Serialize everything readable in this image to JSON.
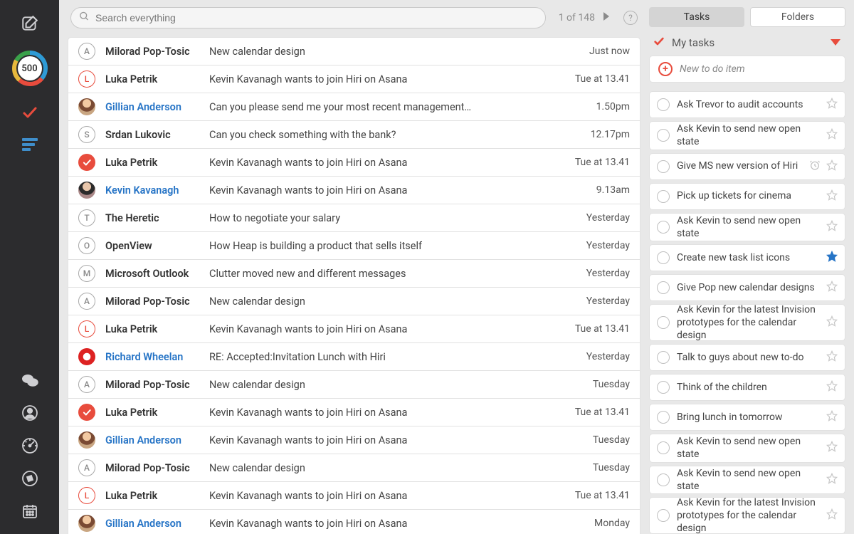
{
  "rail": {
    "score": "500"
  },
  "search": {
    "placeholder": "Search everything"
  },
  "pager": {
    "text": "1 of 148"
  },
  "messages": [
    {
      "avatar": {
        "kind": "letter",
        "text": "A"
      },
      "sender": "Milorad Pop-Tosic",
      "link": false,
      "subject": "New calendar design",
      "when": "Just now"
    },
    {
      "avatar": {
        "kind": "letter-orange",
        "text": "L"
      },
      "sender": "Luka Petrik",
      "link": false,
      "subject": "Kevin Kavanagh wants to join Hiri on Asana",
      "when": "Tue at 13.41"
    },
    {
      "avatar": {
        "kind": "photo-g"
      },
      "sender": "Gillian Anderson",
      "link": true,
      "subject": "Can you please send me your most recent management…",
      "when": "1.50pm"
    },
    {
      "avatar": {
        "kind": "letter",
        "text": "S"
      },
      "sender": "Srdan Lukovic",
      "link": false,
      "subject": "Can you check something with the bank?",
      "when": "12.17pm"
    },
    {
      "avatar": {
        "kind": "check"
      },
      "sender": "Luka Petrik",
      "link": false,
      "subject": "Kevin Kavanagh wants to join Hiri on Asana",
      "when": "Tue at 13.41"
    },
    {
      "avatar": {
        "kind": "photo-k"
      },
      "sender": "Kevin Kavanagh",
      "link": true,
      "subject": "Kevin Kavanagh wants to join Hiri on Asana",
      "when": "9.13am"
    },
    {
      "avatar": {
        "kind": "letter",
        "text": "T"
      },
      "sender": "The Heretic",
      "link": false,
      "subject": "How to negotiate your salary",
      "when": "Yesterday"
    },
    {
      "avatar": {
        "kind": "letter",
        "text": "O"
      },
      "sender": "OpenView",
      "link": false,
      "subject": "How Heap is building a product that sells itself",
      "when": "Yesterday"
    },
    {
      "avatar": {
        "kind": "letter",
        "text": "M"
      },
      "sender": "Microsoft Outlook",
      "link": false,
      "subject": "Clutter moved new and different messages",
      "when": "Yesterday"
    },
    {
      "avatar": {
        "kind": "letter",
        "text": "A"
      },
      "sender": "Milorad Pop-Tosic",
      "link": false,
      "subject": "New calendar design",
      "when": "Yesterday"
    },
    {
      "avatar": {
        "kind": "letter-orange",
        "text": "L"
      },
      "sender": "Luka Petrik",
      "link": false,
      "subject": "Kevin Kavanagh wants to join Hiri on Asana",
      "when": "Tue at 13.41"
    },
    {
      "avatar": {
        "kind": "photo-r"
      },
      "sender": "Richard Wheelan",
      "link": true,
      "subject": "RE: Accepted:Invitation Lunch with Hiri",
      "when": "Yesterday"
    },
    {
      "avatar": {
        "kind": "letter",
        "text": "A"
      },
      "sender": "Milorad Pop-Tosic",
      "link": false,
      "subject": "New calendar design",
      "when": "Tuesday"
    },
    {
      "avatar": {
        "kind": "check"
      },
      "sender": "Luka Petrik",
      "link": false,
      "subject": "Kevin Kavanagh wants to join Hiri on Asana",
      "when": "Tue at 13.41"
    },
    {
      "avatar": {
        "kind": "photo-g"
      },
      "sender": "Gillian Anderson",
      "link": true,
      "subject": "Kevin Kavanagh wants to join Hiri on Asana",
      "when": "Tuesday"
    },
    {
      "avatar": {
        "kind": "letter",
        "text": "A"
      },
      "sender": "Milorad Pop-Tosic",
      "link": false,
      "subject": "New calendar design",
      "when": "Tuesday"
    },
    {
      "avatar": {
        "kind": "letter-orange",
        "text": "L"
      },
      "sender": "Luka Petrik",
      "link": false,
      "subject": "Kevin Kavanagh wants to join Hiri on Asana",
      "when": "Tue at 13.41"
    },
    {
      "avatar": {
        "kind": "photo-g"
      },
      "sender": "Gillian Anderson",
      "link": true,
      "subject": "Kevin Kavanagh wants to join Hiri on Asana",
      "when": "Monday"
    }
  ],
  "tabs": {
    "tasks": "Tasks",
    "folders": "Folders"
  },
  "tasks": {
    "header": "My tasks",
    "new_placeholder": "New to do item",
    "items": [
      {
        "text": "Ask Trevor to audit accounts",
        "star": false,
        "alarm": false
      },
      {
        "text": "Ask Kevin to send new open state",
        "star": false,
        "alarm": false
      },
      {
        "text": "Give MS new version of Hiri",
        "star": false,
        "alarm": true
      },
      {
        "text": "Pick up tickets for cinema",
        "star": false,
        "alarm": false
      },
      {
        "text": "Ask Kevin to send new open state",
        "star": false,
        "alarm": false
      },
      {
        "text": "Create new task list icons",
        "star": true,
        "alarm": false
      },
      {
        "text": "Give Pop new calendar designs",
        "star": false,
        "alarm": false
      },
      {
        "text": "Ask Kevin for the latest Invision prototypes for the calendar design",
        "star": false,
        "alarm": false
      },
      {
        "text": "Talk to guys about new to-do",
        "star": false,
        "alarm": false
      },
      {
        "text": "Think of the children",
        "star": false,
        "alarm": false
      },
      {
        "text": "Bring lunch in tomorrow",
        "star": false,
        "alarm": false
      },
      {
        "text": "Ask Kevin to send new open state",
        "star": false,
        "alarm": false
      },
      {
        "text": "Ask Kevin to send new open state",
        "star": false,
        "alarm": false
      },
      {
        "text": "Ask Kevin for the latest Invision prototypes for the calendar design",
        "star": false,
        "alarm": false
      }
    ]
  }
}
